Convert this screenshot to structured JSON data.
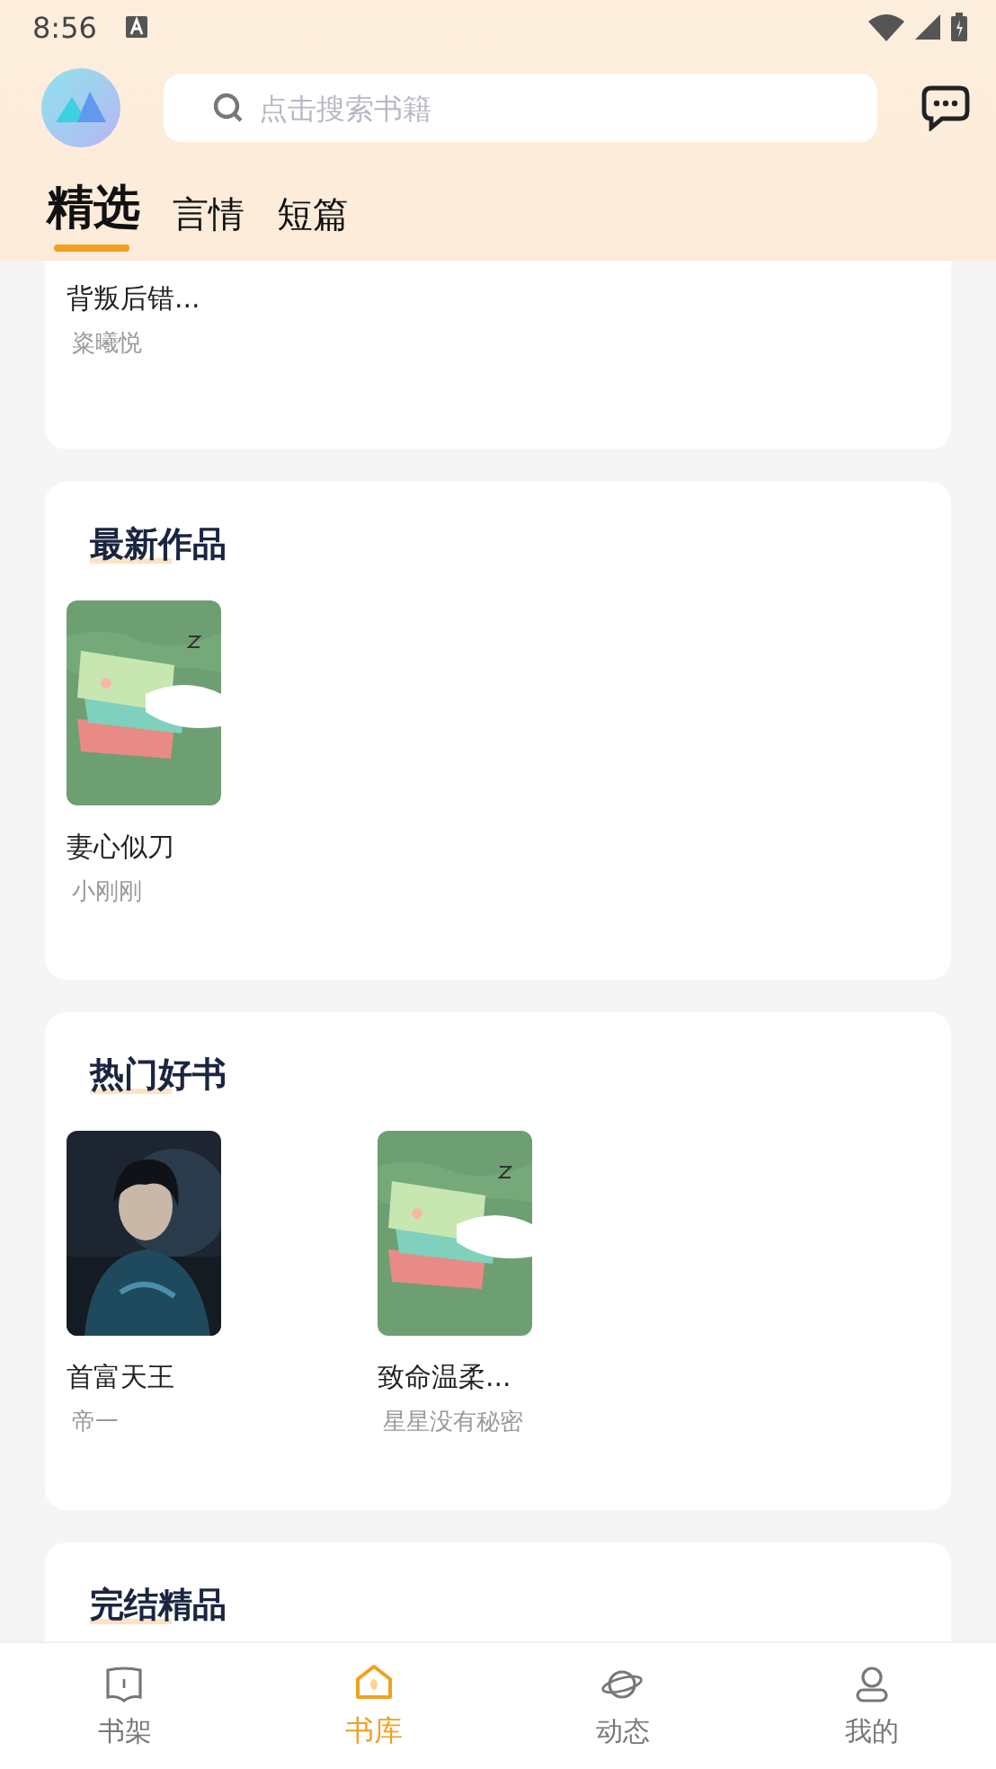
{
  "status_bar": {
    "time": "8:56"
  },
  "search": {
    "placeholder": "点击搜索书籍"
  },
  "tabs": [
    {
      "label": "精选",
      "selected": true
    },
    {
      "label": "言情",
      "selected": false
    },
    {
      "label": "短篇",
      "selected": false
    }
  ],
  "sections": [
    {
      "books": [
        {
          "title": "背叛后错...",
          "author": "粢曦悦"
        }
      ]
    },
    {
      "title": "最新作品",
      "books": [
        {
          "title": "妻心似刀",
          "author": "小刚刚",
          "kind": "picture"
        }
      ]
    },
    {
      "title": "热门好书",
      "books": [
        {
          "title": "首富天王",
          "author": "帝一",
          "kind": "picture"
        },
        {
          "title": "致命温柔...",
          "author": "星星没有秘密",
          "kind": "picture"
        }
      ]
    },
    {
      "title": "完结精品"
    }
  ],
  "bottom_nav": [
    {
      "label": "书架",
      "selected": false
    },
    {
      "label": "书库",
      "selected": true
    },
    {
      "label": "动态",
      "selected": false
    },
    {
      "label": "我的",
      "selected": false
    }
  ]
}
